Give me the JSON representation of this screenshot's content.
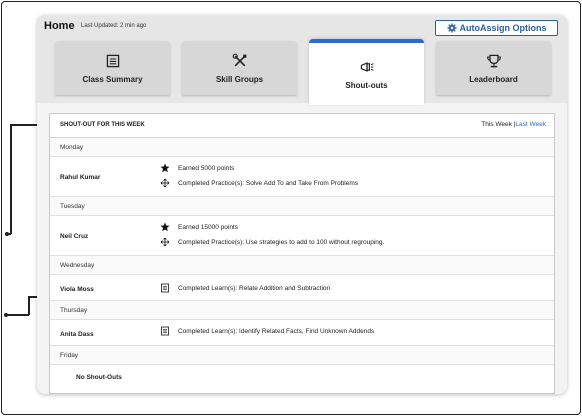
{
  "header": {
    "title": "Home",
    "last_updated": "Last Updated: 2 min ago",
    "autoassign_label": "AutoAssign Options"
  },
  "tabs": [
    {
      "label": "Class Summary",
      "icon": "list-icon",
      "active": false
    },
    {
      "label": "Skill Groups",
      "icon": "tools-icon",
      "active": false
    },
    {
      "label": "Shout-outs",
      "icon": "megaphone-icon",
      "active": true
    },
    {
      "label": "Leaderboard",
      "icon": "trophy-icon",
      "active": false
    }
  ],
  "panel": {
    "title": "SHOUT-OUT FOR THIS WEEK",
    "this_week": "This Week",
    "separator": "|",
    "last_week": "Last Week"
  },
  "days": {
    "monday": "Monday",
    "tuesday": "Tuesday",
    "wednesday": "Wednesday",
    "thursday": "Thursday",
    "friday": "Friday"
  },
  "students": {
    "rahul": {
      "name": "Rahul Kumar",
      "entries": [
        "Earned 5000 points",
        "Completed Practice(s): Solve Add To and Take From Problems"
      ]
    },
    "neil": {
      "name": "Neil Cruz",
      "entries": [
        "Earned 15000 points",
        "Completed Practice(s): Use strategies to add to 100 without regrouping."
      ]
    },
    "viola": {
      "name": "Viola Moss",
      "entries": [
        "Completed Learn(s): Relate Addition and Subtraction"
      ]
    },
    "anita": {
      "name": "Anita Dass",
      "entries": [
        "Completed Learn(s): Identify Related Facts, Find Unknown Addends"
      ]
    },
    "friday_empty": "No Shout-Outs"
  },
  "colors": {
    "accent": "#2a6bd6",
    "autoassign": "#2d5fa0"
  }
}
